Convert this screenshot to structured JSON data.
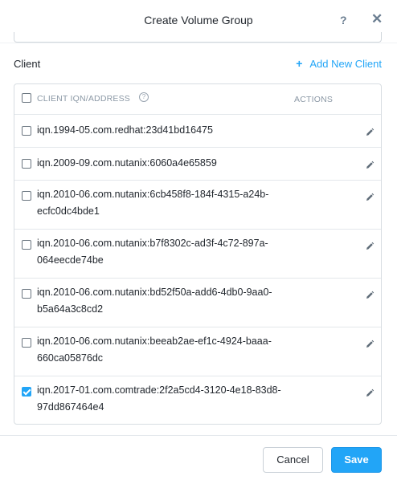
{
  "dialog": {
    "title": "Create Volume Group",
    "help_label": "?",
    "close_label": "✕"
  },
  "client": {
    "label": "Client",
    "add_label": "Add New Client",
    "add_icon": "+"
  },
  "table": {
    "headers": {
      "iqn": "CLIENT IQN/ADDRESS",
      "info_icon": "?",
      "actions": "ACTIONS"
    },
    "header_checked": false,
    "rows": [
      {
        "iqn": "iqn.1994-05.com.redhat:23d41bd16475",
        "checked": false
      },
      {
        "iqn": "iqn.2009-09.com.nutanix:6060a4e65859",
        "checked": false
      },
      {
        "iqn": "iqn.2010-06.com.nutanix:6cb458f8-184f-4315-a24b-ecfc0dc4bde1",
        "checked": false
      },
      {
        "iqn": "iqn.2010-06.com.nutanix:b7f8302c-ad3f-4c72-897a-064eecde74be",
        "checked": false
      },
      {
        "iqn": "iqn.2010-06.com.nutanix:bd52f50a-add6-4db0-9aa0-b5a64a3c8cd2",
        "checked": false
      },
      {
        "iqn": "iqn.2010-06.com.nutanix:beeab2ae-ef1c-4924-baaa-660ca05876dc",
        "checked": false
      },
      {
        "iqn": "iqn.2017-01.com.comtrade:2f2a5cd4-3120-4e18-83d8-97dd867464e4",
        "checked": true
      }
    ]
  },
  "footer": {
    "cancel_label": "Cancel",
    "save_label": "Save"
  },
  "colors": {
    "accent": "#22a5f7",
    "text": "#22272e",
    "muted": "#8b98a5",
    "border": "#d8dde2"
  },
  "icons": {
    "edit": "pencil-icon",
    "help": "question-icon",
    "close": "close-icon",
    "add": "plus-icon",
    "info": "info-circle-icon"
  }
}
